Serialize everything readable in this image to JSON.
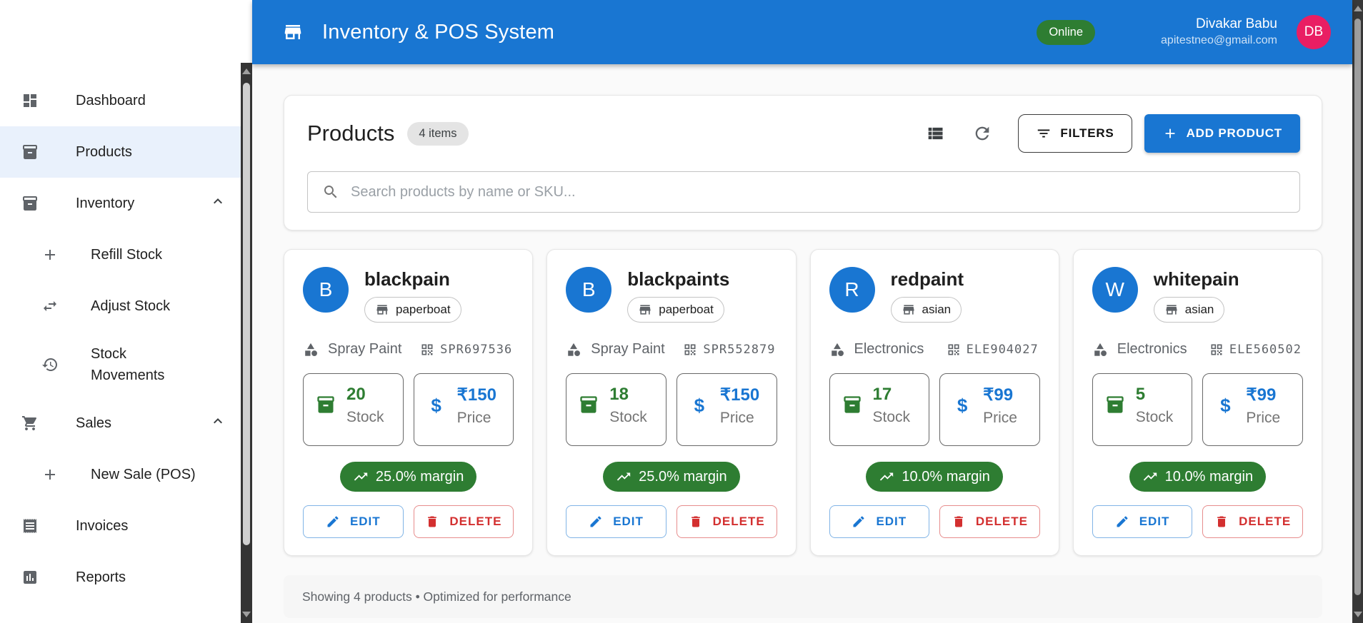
{
  "header": {
    "title": "Inventory & POS System",
    "status": "Online",
    "user_name": "Divakar Babu",
    "user_email": "apitestneo@gmail.com",
    "avatar_initials": "DB"
  },
  "sidebar": {
    "items": [
      {
        "label": "Dashboard",
        "icon": "dashboard-icon"
      },
      {
        "label": "Products",
        "icon": "inventory-box-icon",
        "selected": true
      },
      {
        "label": "Inventory",
        "icon": "inventory-box-icon",
        "expanded": true
      },
      {
        "label": "Refill Stock",
        "icon": "plus-icon",
        "sub": true
      },
      {
        "label": "Adjust Stock",
        "icon": "swap-arrows-icon",
        "sub": true
      },
      {
        "label": "Stock Movements",
        "icon": "history-icon",
        "sub": true
      },
      {
        "label": "Sales",
        "icon": "cart-icon",
        "expanded": true
      },
      {
        "label": "New Sale (POS)",
        "icon": "plus-icon",
        "sub": true
      },
      {
        "label": "Invoices",
        "icon": "receipt-icon"
      },
      {
        "label": "Reports",
        "icon": "bar-chart-icon"
      }
    ]
  },
  "toolbar": {
    "heading": "Products",
    "count_badge": "4 items",
    "filters_label": "FILTERS",
    "add_label": "ADD PRODUCT"
  },
  "search": {
    "placeholder": "Search products by name or SKU..."
  },
  "products": [
    {
      "initial": "B",
      "name": "blackpain",
      "brand": "paperboat",
      "category": "Spray Paint",
      "sku": "SPR697536",
      "stock": "20",
      "price": "₹150",
      "margin": "25.0% margin"
    },
    {
      "initial": "B",
      "name": "blackpaints",
      "brand": "paperboat",
      "category": "Spray Paint",
      "sku": "SPR552879",
      "stock": "18",
      "price": "₹150",
      "margin": "25.0% margin"
    },
    {
      "initial": "R",
      "name": "redpaint",
      "brand": "asian",
      "category": "Electronics",
      "sku": "ELE904027",
      "stock": "17",
      "price": "₹99",
      "margin": "10.0% margin"
    },
    {
      "initial": "W",
      "name": "whitepain",
      "brand": "asian",
      "category": "Electronics",
      "sku": "ELE560502",
      "stock": "5",
      "price": "₹99",
      "margin": "10.0% margin"
    }
  ],
  "labels": {
    "stock": "Stock",
    "price": "Price",
    "currency": "$",
    "edit": "EDIT",
    "delete": "DELETE"
  },
  "footer": {
    "summary": "Showing 4 products • Optimized for performance"
  },
  "colors": {
    "primary_blue": "#1976d2",
    "success_green": "#2e7d32",
    "danger_red": "#d32f2f",
    "avatar_pink": "#e91e63",
    "selected_nav_bg": "#e9f1fc"
  }
}
